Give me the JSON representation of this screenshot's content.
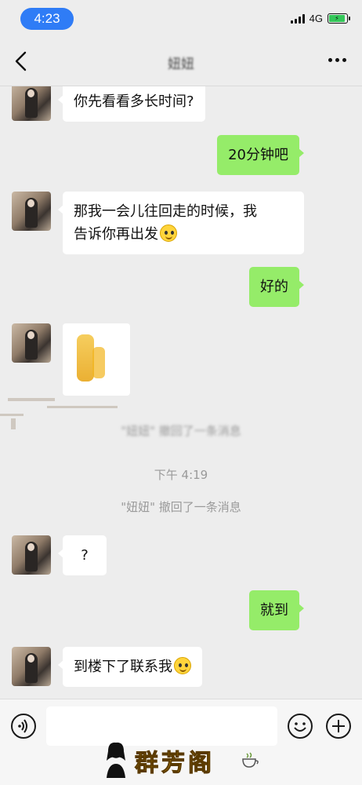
{
  "status_bar": {
    "time": "4:23",
    "network": "4G",
    "battery_level": 0.9
  },
  "nav": {
    "title": "妞妞"
  },
  "messages": [
    {
      "side": "in",
      "text": "你先看看多长时间?"
    },
    {
      "side": "out",
      "text": "20分钟吧"
    },
    {
      "side": "in",
      "line1": "那我一会儿往回走的时候，我",
      "line2": "告诉你再出发"
    },
    {
      "side": "out",
      "text": "好的"
    },
    {
      "side": "in",
      "type": "sticker"
    },
    {
      "side": "in",
      "text": "?"
    },
    {
      "side": "out",
      "text": "就到"
    },
    {
      "side": "in",
      "text": "到楼下了联系我"
    }
  ],
  "system": {
    "recall_top": "\"妞妞\" 撤回了一条消息",
    "timestamp": "下午 4:19",
    "recall": "\"妞妞\" 撤回了一条消息"
  },
  "input": {
    "placeholder": ""
  },
  "watermark": {
    "text": "群芳阁"
  }
}
